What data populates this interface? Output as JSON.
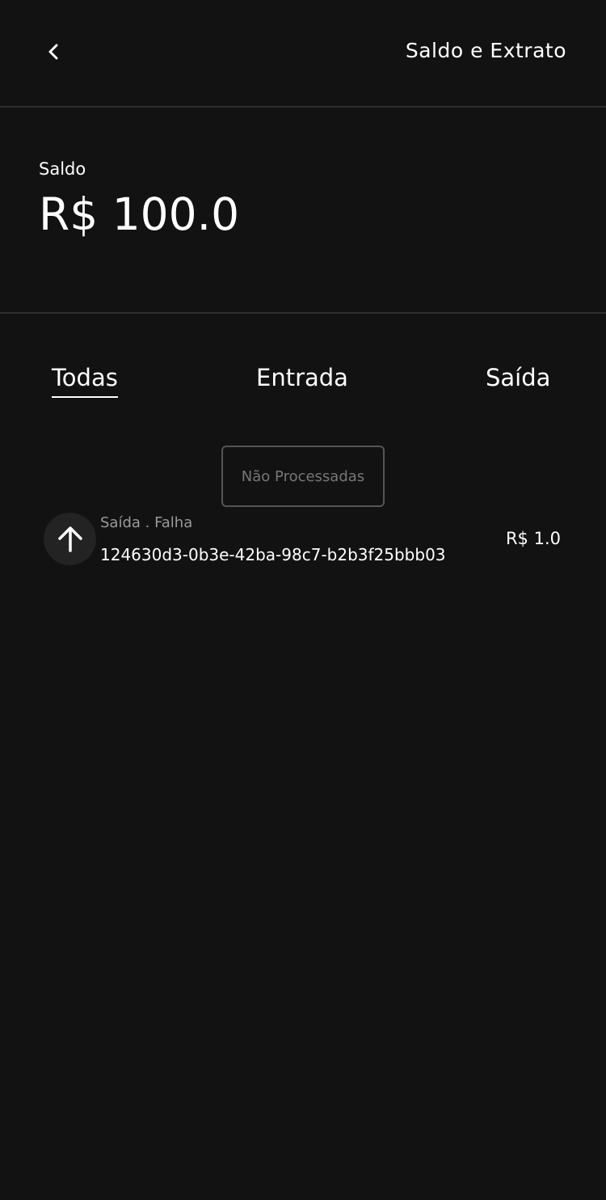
{
  "header": {
    "title": "Saldo e Extrato",
    "back_icon": "chevron-left-icon"
  },
  "balance": {
    "label": "Saldo",
    "value": "R$ 100.0"
  },
  "tabs": [
    {
      "label": "Todas",
      "active": true
    },
    {
      "label": "Entrada",
      "active": false
    },
    {
      "label": "Saída",
      "active": false
    }
  ],
  "filter": {
    "label": "Não Processadas"
  },
  "transactions": [
    {
      "icon": "arrow-up-icon",
      "status": "Saída . Falha",
      "id": "124630d3-0b3e-42ba-98c7-b2b3f25bbb03",
      "amount": "R$ 1.0"
    }
  ],
  "colors": {
    "background": "#121212",
    "divider": "#2e2e2e",
    "text": "#ffffff",
    "muted_text": "#9a9a9a",
    "chip_border": "#555555",
    "icon_circle": "#232323"
  }
}
